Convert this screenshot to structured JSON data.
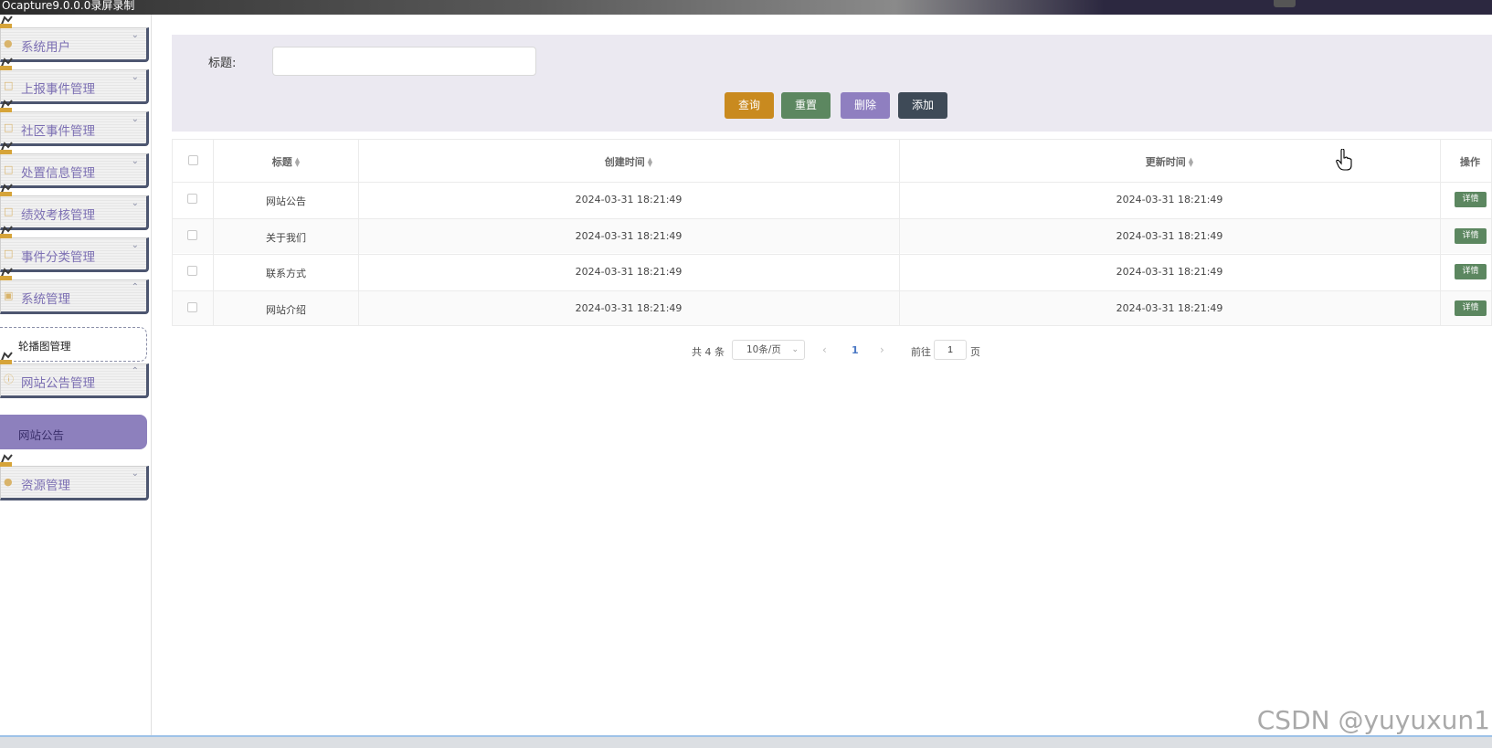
{
  "topbar": {
    "title": "Ocapture9.0.0.0录屏录制"
  },
  "sidebar": {
    "menus": [
      {
        "label": "系统用户",
        "icon": "user-icon"
      },
      {
        "label": "上报事件管理",
        "icon": "document-icon"
      },
      {
        "label": "社区事件管理",
        "icon": "document-icon"
      },
      {
        "label": "处置信息管理",
        "icon": "document-icon"
      },
      {
        "label": "绩效考核管理",
        "icon": "document-icon"
      },
      {
        "label": "事件分类管理",
        "icon": "document-icon"
      },
      {
        "label": "系统管理",
        "icon": "image-icon"
      },
      {
        "label": "网站公告管理",
        "icon": "info-icon"
      },
      {
        "label": "资源管理",
        "icon": "bulb-icon"
      }
    ],
    "sub_carousel": "轮播图管理",
    "sub_active": "网站公告"
  },
  "search": {
    "label": "标题:",
    "value": ""
  },
  "buttons": {
    "query": "查询",
    "reset": "重置",
    "delete": "删除",
    "add": "添加"
  },
  "table": {
    "headers": {
      "title": "标题",
      "created": "创建时间",
      "updated": "更新时间",
      "action": "操作"
    },
    "rows": [
      {
        "title": "网站公告",
        "created": "2024-03-31 18:21:49",
        "updated": "2024-03-31 18:21:49",
        "action": "详情"
      },
      {
        "title": "关于我们",
        "created": "2024-03-31 18:21:49",
        "updated": "2024-03-31 18:21:49",
        "action": "详情"
      },
      {
        "title": "联系方式",
        "created": "2024-03-31 18:21:49",
        "updated": "2024-03-31 18:21:49",
        "action": "详情"
      },
      {
        "title": "网站介绍",
        "created": "2024-03-31 18:21:49",
        "updated": "2024-03-31 18:21:49",
        "action": "详情"
      }
    ]
  },
  "pagination": {
    "total": "共 4 条",
    "page_size": "10条/页",
    "current_page": "1",
    "goto_label": "前往",
    "goto_value": "1",
    "page_suffix": "页"
  },
  "watermark": "CSDN @yuyuxun1",
  "colors": {
    "sidebar_text": "#7c6fb3",
    "active_item": "#8d80bd",
    "query": "#c98a1f",
    "reset": "#5c8760",
    "delete": "#8f7fc0",
    "add": "#3e4a57"
  }
}
